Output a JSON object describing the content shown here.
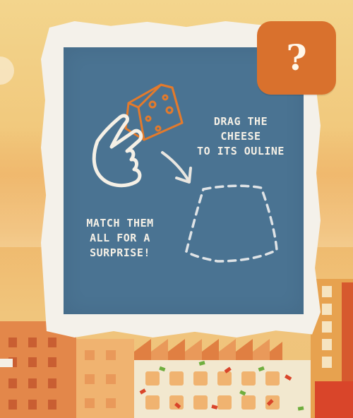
{
  "help_button": {
    "icon": "question-mark-icon",
    "label": "?"
  },
  "tutorial": {
    "instruction_drag": "DRAG THE\nCHEESE\nTO ITS OULINE",
    "instruction_match": "MATCH THEM\nALL FOR A\nSURPRISE!"
  },
  "colors": {
    "card_blue": "#4a7392",
    "accent_orange": "#d9712d",
    "cheese_orange": "#e37a2c",
    "chalk_white": "#f5f0e6",
    "sky_yellow": "#f3d58d"
  },
  "icons": [
    "cheese-icon",
    "hand-pointer-icon",
    "arrow-down-right-icon",
    "dashed-outline-target-icon",
    "question-mark-icon"
  ]
}
